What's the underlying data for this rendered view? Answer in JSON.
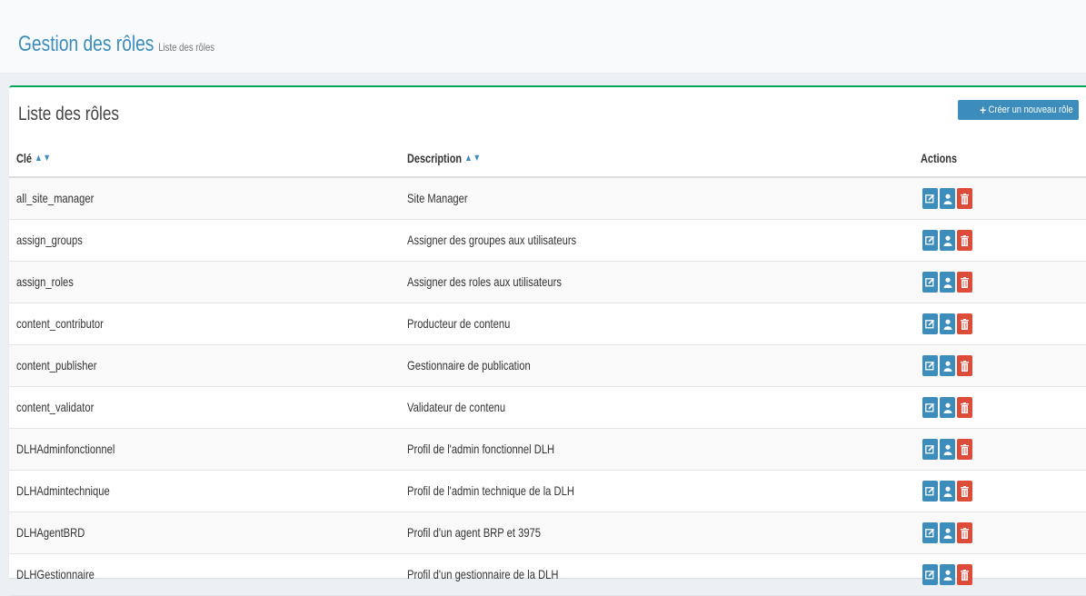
{
  "header": {
    "title": "Gestion des rôles",
    "subtitle": "Liste des rôles"
  },
  "box": {
    "title": "Liste des rôles",
    "create_button": "Créer un nouveau rôle"
  },
  "table": {
    "columns": {
      "key": "Clé",
      "description": "Description",
      "actions": "Actions"
    },
    "rows": [
      {
        "key": "all_site_manager",
        "description": "Site Manager"
      },
      {
        "key": "assign_groups",
        "description": "Assigner des groupes aux utilisateurs"
      },
      {
        "key": "assign_roles",
        "description": "Assigner des roles aux utilisateurs"
      },
      {
        "key": "content_contributor",
        "description": "Producteur de contenu"
      },
      {
        "key": "content_publisher",
        "description": "Gestionnaire de publication"
      },
      {
        "key": "content_validator",
        "description": "Validateur de contenu"
      },
      {
        "key": "DLHAdminfonctionnel",
        "description": "Profil de l'admin fonctionnel DLH"
      },
      {
        "key": "DLHAdmintechnique",
        "description": "Profil de l'admin technique de la DLH"
      },
      {
        "key": "DLHAgentBRD",
        "description": "Profil d'un agent BRP et 3975"
      },
      {
        "key": "DLHGestionnaire",
        "description": "Profil d'un gestionnaire de la DLH"
      }
    ],
    "row_actions": [
      "edit-icon",
      "user-icon",
      "trash-icon"
    ]
  },
  "colors": {
    "primary": "#3c8dbc",
    "danger": "#dd4b39",
    "box_border": "#00a65a"
  }
}
